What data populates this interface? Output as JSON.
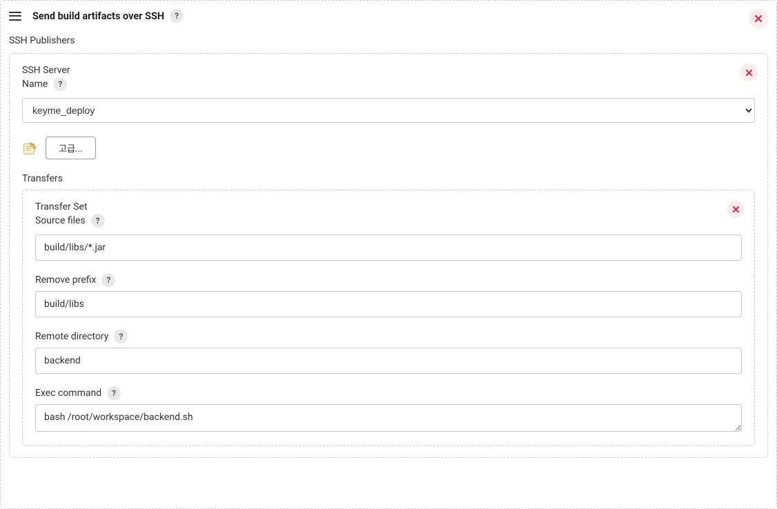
{
  "section": {
    "title": "Send build artifacts over SSH"
  },
  "publishers_label": "SSH Publishers",
  "server": {
    "heading": "SSH Server",
    "name_label": "Name",
    "selected": "keyme_deploy",
    "advanced_button": "고급..."
  },
  "transfers_label": "Transfers",
  "transfer_set": {
    "heading": "Transfer Set",
    "source_files_label": "Source files",
    "source_files_value": "build/libs/*.jar",
    "remove_prefix_label": "Remove prefix",
    "remove_prefix_value": "build/libs",
    "remote_directory_label": "Remote directory",
    "remote_directory_value": "backend",
    "exec_command_label": "Exec command",
    "exec_command_value": "bash /root/workspace/backend.sh"
  }
}
